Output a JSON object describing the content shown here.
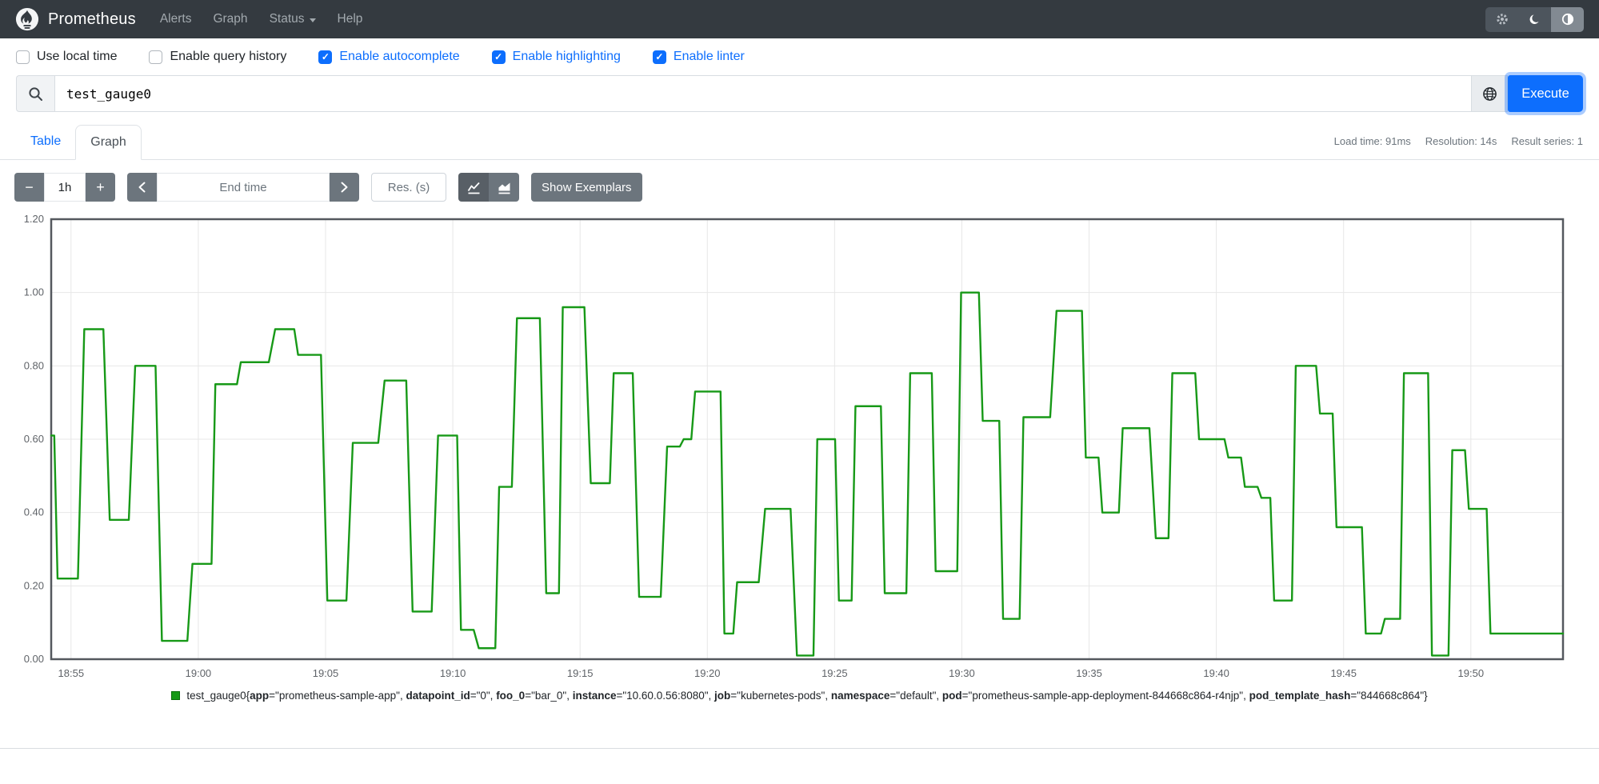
{
  "navbar": {
    "brand": "Prometheus",
    "items": [
      {
        "label": "Alerts",
        "has_caret": false
      },
      {
        "label": "Graph",
        "has_caret": false
      },
      {
        "label": "Status",
        "has_caret": true
      },
      {
        "label": "Help",
        "has_caret": false
      }
    ],
    "colors": {
      "background": "#343a40",
      "link": "#a2a9ae"
    }
  },
  "options": [
    {
      "label": "Use local time",
      "checked": false
    },
    {
      "label": "Enable query history",
      "checked": false
    },
    {
      "label": "Enable autocomplete",
      "checked": true
    },
    {
      "label": "Enable highlighting",
      "checked": true
    },
    {
      "label": "Enable linter",
      "checked": true
    }
  ],
  "query": {
    "value": "test_gauge0",
    "execute_label": "Execute",
    "accent_color": "#0d6efd",
    "icons": [
      "search-icon",
      "globe-icon"
    ]
  },
  "stats": [
    "Load time: 91ms",
    "Resolution: 14s",
    "Result series: 1"
  ],
  "tabs": [
    {
      "label": "Table",
      "active": false
    },
    {
      "label": "Graph",
      "active": true
    }
  ],
  "controls": {
    "minus": "−",
    "plus": "+",
    "range_value": "1h",
    "end_time_placeholder": "End time",
    "res_placeholder": "Res. (s)",
    "show_exemplars": "Show Exemplars",
    "chart_type_icons": [
      "line-chart-icon",
      "stacked-chart-icon"
    ],
    "active_chart_type": "line"
  },
  "chart_data": {
    "type": "line",
    "title": "test_gauge0",
    "xlabel": "",
    "ylabel": "",
    "ylim": [
      0,
      1.2
    ],
    "yticks": [
      "0.00",
      "0.20",
      "0.40",
      "0.60",
      "0.80",
      "1.00",
      "1.20"
    ],
    "grid": true,
    "legend_position": "bottom",
    "line_color": "#179917",
    "grid_color": "#e7e7e7",
    "border_color": "#54585e",
    "tick_text_color": "#5f6368",
    "duration_min": 59.4,
    "window_label": "1h",
    "x_ticks": [
      {
        "label": "18:55",
        "t": 0.78
      },
      {
        "label": "19:00",
        "t": 5.78
      },
      {
        "label": "19:05",
        "t": 10.78
      },
      {
        "label": "19:10",
        "t": 15.78
      },
      {
        "label": "19:15",
        "t": 20.78
      },
      {
        "label": "19:20",
        "t": 25.78
      },
      {
        "label": "19:25",
        "t": 30.78
      },
      {
        "label": "19:30",
        "t": 35.78
      },
      {
        "label": "19:35",
        "t": 40.78
      },
      {
        "label": "19:40",
        "t": 45.78
      },
      {
        "label": "19:45",
        "t": 50.78
      },
      {
        "label": "19:50",
        "t": 55.78
      }
    ],
    "series": [
      {
        "name": "test_gauge0",
        "segments": [
          [
            0.0,
            0.12,
            0.61
          ],
          [
            0.25,
            1.05,
            0.22
          ],
          [
            1.3,
            2.05,
            0.9
          ],
          [
            2.3,
            3.05,
            0.38
          ],
          [
            3.3,
            4.1,
            0.8
          ],
          [
            4.35,
            5.35,
            0.05
          ],
          [
            5.55,
            6.3,
            0.26
          ],
          [
            6.45,
            7.3,
            0.75
          ],
          [
            7.45,
            8.55,
            0.81
          ],
          [
            8.8,
            9.55,
            0.9
          ],
          [
            9.7,
            10.6,
            0.83
          ],
          [
            10.85,
            11.6,
            0.16
          ],
          [
            11.85,
            12.85,
            0.59
          ],
          [
            13.1,
            13.95,
            0.76
          ],
          [
            14.2,
            14.95,
            0.13
          ],
          [
            15.2,
            15.95,
            0.61
          ],
          [
            16.1,
            16.6,
            0.08
          ],
          [
            16.8,
            17.45,
            0.03
          ],
          [
            17.6,
            18.1,
            0.47
          ],
          [
            18.3,
            19.2,
            0.93
          ],
          [
            19.45,
            19.95,
            0.18
          ],
          [
            20.1,
            20.95,
            0.96
          ],
          [
            21.2,
            21.95,
            0.48
          ],
          [
            22.1,
            22.85,
            0.78
          ],
          [
            23.1,
            23.95,
            0.17
          ],
          [
            24.2,
            24.7,
            0.58
          ],
          [
            24.85,
            25.15,
            0.6
          ],
          [
            25.3,
            26.3,
            0.73
          ],
          [
            26.45,
            26.8,
            0.07
          ],
          [
            26.95,
            27.8,
            0.21
          ],
          [
            28.05,
            29.05,
            0.41
          ],
          [
            29.3,
            29.95,
            0.01
          ],
          [
            30.1,
            30.8,
            0.6
          ],
          [
            30.95,
            31.45,
            0.16
          ],
          [
            31.6,
            32.6,
            0.69
          ],
          [
            32.75,
            33.6,
            0.18
          ],
          [
            33.75,
            34.6,
            0.78
          ],
          [
            34.75,
            35.6,
            0.24
          ],
          [
            35.75,
            36.45,
            1.0
          ],
          [
            36.6,
            37.25,
            0.65
          ],
          [
            37.4,
            38.05,
            0.11
          ],
          [
            38.2,
            39.25,
            0.66
          ],
          [
            39.5,
            40.5,
            0.95
          ],
          [
            40.65,
            41.15,
            0.55
          ],
          [
            41.3,
            41.95,
            0.4
          ],
          [
            42.1,
            43.15,
            0.63
          ],
          [
            43.4,
            43.9,
            0.33
          ],
          [
            44.05,
            44.95,
            0.78
          ],
          [
            45.1,
            46.1,
            0.6
          ],
          [
            46.25,
            46.75,
            0.55
          ],
          [
            46.9,
            47.4,
            0.47
          ],
          [
            47.55,
            47.9,
            0.44
          ],
          [
            48.05,
            48.75,
            0.16
          ],
          [
            48.9,
            49.7,
            0.8
          ],
          [
            49.85,
            50.35,
            0.67
          ],
          [
            50.5,
            51.5,
            0.36
          ],
          [
            51.65,
            52.25,
            0.07
          ],
          [
            52.4,
            53.0,
            0.11
          ],
          [
            53.15,
            54.1,
            0.78
          ],
          [
            54.25,
            54.9,
            0.01
          ],
          [
            55.05,
            55.55,
            0.57
          ],
          [
            55.7,
            56.4,
            0.41
          ],
          [
            56.55,
            59.4,
            0.07
          ]
        ]
      }
    ]
  },
  "legend": {
    "series_name": "test_gauge0",
    "swatch_color": "#179917",
    "labels": [
      {
        "name": "app",
        "value": "prometheus-sample-app"
      },
      {
        "name": "datapoint_id",
        "value": "0"
      },
      {
        "name": "foo_0",
        "value": "bar_0"
      },
      {
        "name": "instance",
        "value": "10.60.0.56:8080"
      },
      {
        "name": "job",
        "value": "kubernetes-pods"
      },
      {
        "name": "namespace",
        "value": "default"
      },
      {
        "name": "pod",
        "value": "prometheus-sample-app-deployment-844668c864-r4njp"
      },
      {
        "name": "pod_template_hash",
        "value": "844668c864"
      }
    ]
  }
}
